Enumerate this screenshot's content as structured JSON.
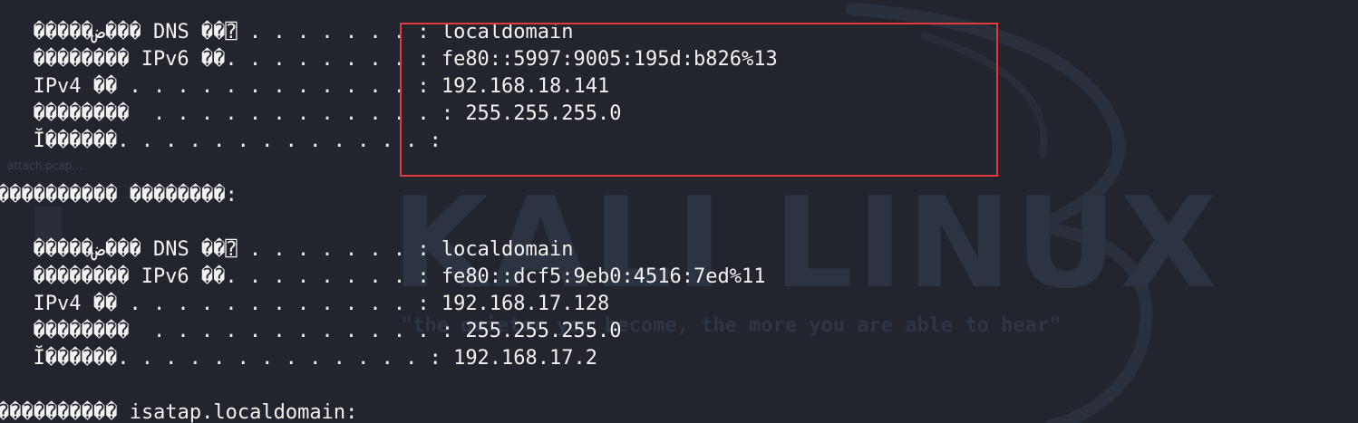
{
  "background": {
    "watermark": "KALI LINUX",
    "tagline": "\"the quieter you become, the more you are able to hear\"",
    "file_label": "attach.pcap..."
  },
  "terminal": {
    "lines": [
      "  �����ض��� DNS ��⍰ . . . . . . . : localdomain",
      "  �������� IPv6 ��. . . . . . . . : fe80::5997:9005:195d:b826%13",
      "  IPv4 �� . . . . . . . . . . . . : 192.168.18.141",
      "  ��������  . . . . . . . . . . . . : 255.255.255.0",
      "  Ĭ������. . . . . . . . . . . . . :",
      "",
      "���������� ��������:",
      "",
      "  �����ض��� DNS ��⍰ . . . . . . . : localdomain",
      "  �������� IPv6 ��. . . . . . . . : fe80::dcf5:9eb0:4516:7ed%11",
      "  IPv4 �� . . . . . . . . . . . . : 192.168.17.128",
      "  ��������  . . . . . . . . . . . . : 255.255.255.0",
      "  Ĭ������. . . . . . . . . . . . . : 192.168.17.2",
      "",
      "���������� isatap.localdomain:"
    ]
  },
  "colors": {
    "background": "#23252e",
    "text": "#f2f2f2",
    "highlight_border": "#e03a3a"
  }
}
